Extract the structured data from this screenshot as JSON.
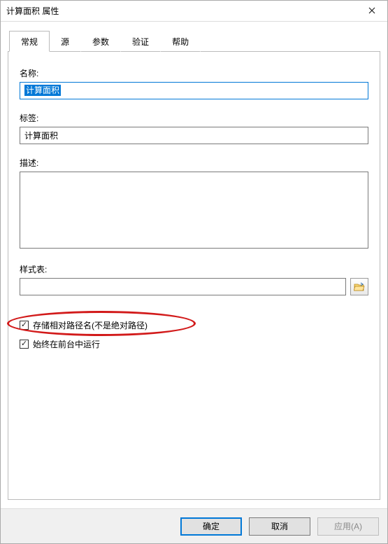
{
  "window": {
    "title": "计算面积 属性"
  },
  "tabs": {
    "general": "常规",
    "source": "源",
    "params": "参数",
    "validate": "验证",
    "help": "帮助"
  },
  "labels": {
    "name": "名称:",
    "tag": "标签:",
    "desc": "描述:",
    "stylesheet": "样式表:"
  },
  "values": {
    "name": "计算面积",
    "tag": "计算面积",
    "desc": "",
    "stylesheet": ""
  },
  "checkboxes": {
    "relative": {
      "label": "存储相对路径名(不是绝对路径)",
      "checked": true
    },
    "foreground": {
      "label": "始终在前台中运行",
      "checked": true
    }
  },
  "buttons": {
    "ok": "确定",
    "cancel": "取消",
    "apply": "应用(A)"
  },
  "icons": {
    "close": "close-icon",
    "browse": "folder-open-icon"
  }
}
